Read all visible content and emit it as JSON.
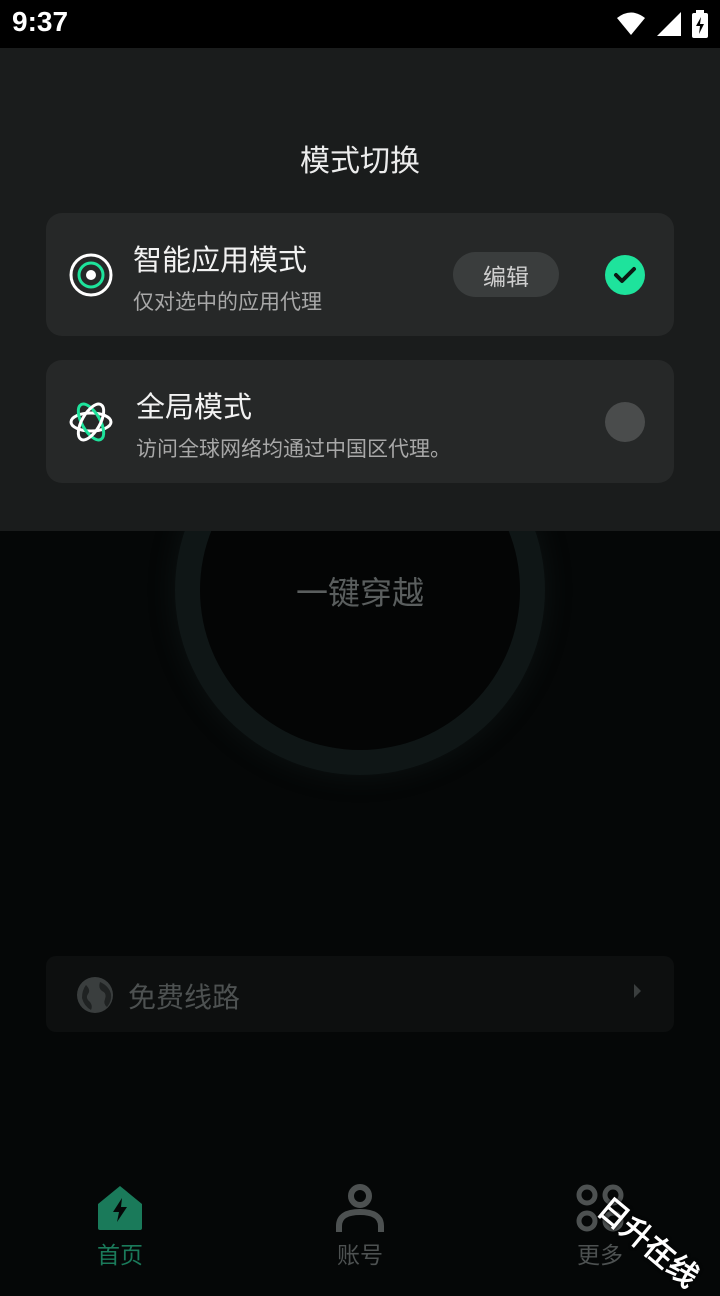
{
  "status_bar": {
    "time": "9:37",
    "icons": [
      "wifi-icon",
      "signal-icon",
      "battery-charging-icon"
    ]
  },
  "sheet": {
    "title": "模式切换",
    "modes": [
      {
        "title": "智能应用模式",
        "subtitle": "仅对选中的应用代理",
        "edit_label": "编辑",
        "selected": true,
        "icon": "target-icon"
      },
      {
        "title": "全局模式",
        "subtitle": "访问全球网络均通过中国区代理。",
        "selected": false,
        "icon": "atom-icon"
      }
    ]
  },
  "main": {
    "connect_label": "一键穿越",
    "route_label": "免费线路"
  },
  "tabs": [
    {
      "label": "首页",
      "icon": "home-bolt-icon",
      "active": true
    },
    {
      "label": "账号",
      "icon": "user-icon",
      "active": false
    },
    {
      "label": "更多",
      "icon": "grid-dots-icon",
      "active": false
    }
  ],
  "watermark": "日升在线",
  "colors": {
    "accent": "#1ee39c",
    "tab_active": "#1a7a5a",
    "tab_inactive": "#4d5151"
  }
}
